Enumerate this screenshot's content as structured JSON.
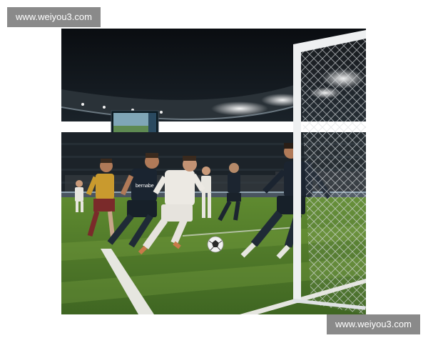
{
  "watermarks": {
    "top_left": "www.weiyou3.com",
    "bottom_right": "www.weiyou3.com"
  },
  "photo": {
    "ball_brand_label": "",
    "jersey_sponsor": "bernabe",
    "colors": {
      "sky": "#0d1116",
      "stands": "#1b2228",
      "pitch": "#4f7a2a",
      "pitch_light": "#6a9436",
      "white_kit": "#e9e6e0",
      "dark_kit": "#1c2530",
      "yellow_kit": "#c79a2c",
      "maroon_shorts": "#7a2a2a",
      "net": "#dfe3e6"
    }
  }
}
